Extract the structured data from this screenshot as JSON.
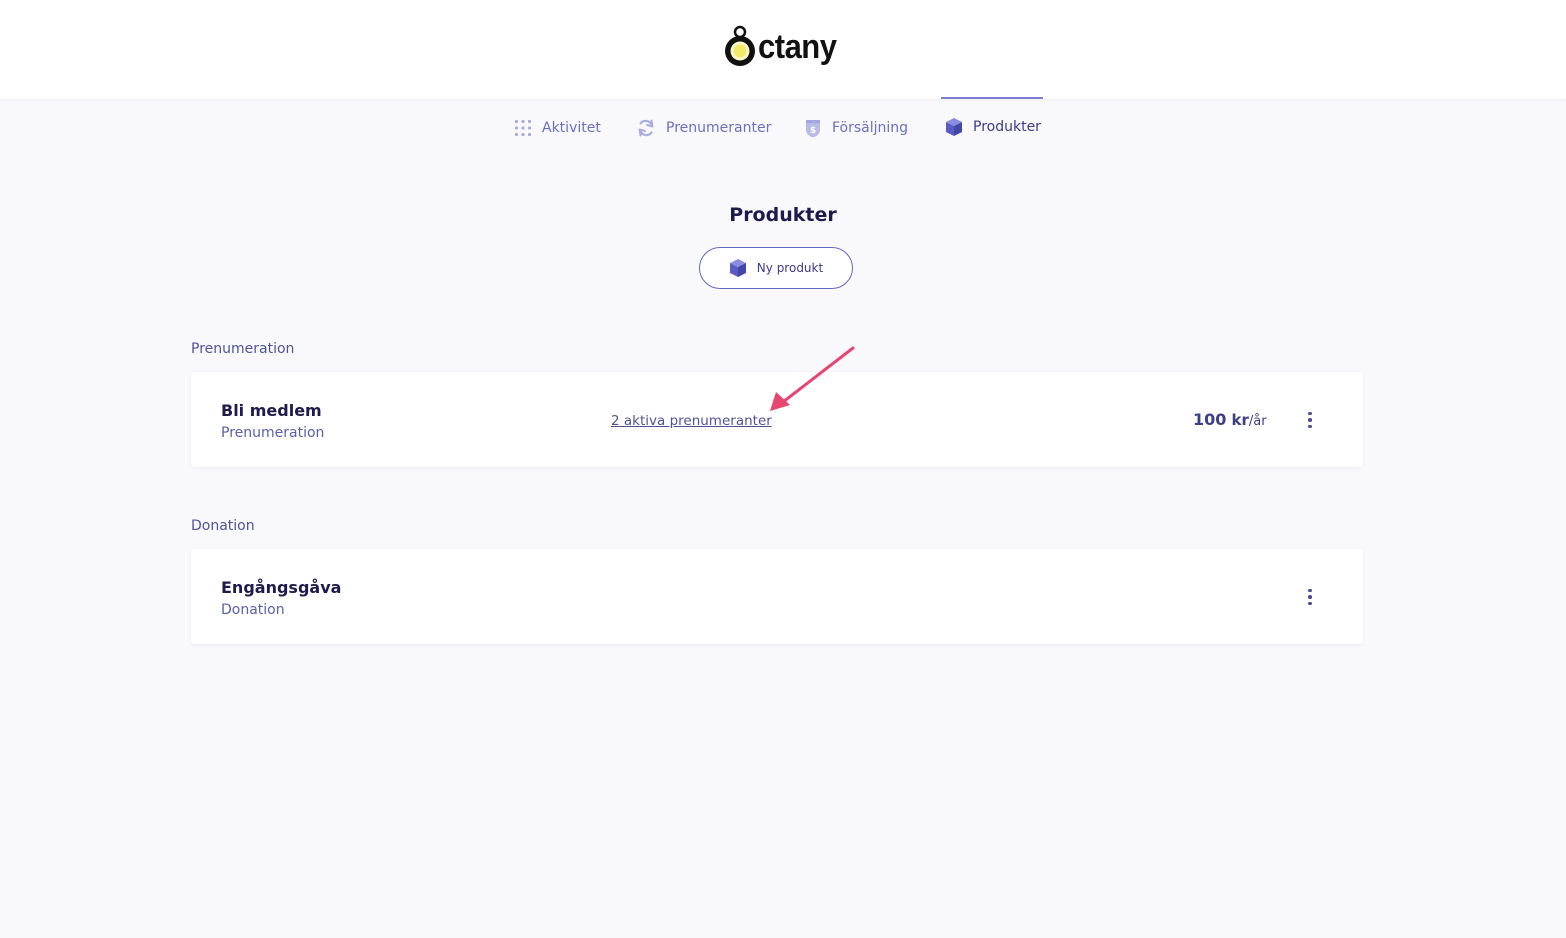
{
  "brand": {
    "name": "ctany"
  },
  "nav": {
    "items": [
      {
        "label": "Aktivitet",
        "icon": "grid-icon",
        "active": false
      },
      {
        "label": "Prenumeranter",
        "icon": "refresh-icon",
        "active": false
      },
      {
        "label": "Försäljning",
        "icon": "dollar-shield-icon",
        "active": false
      },
      {
        "label": "Produkter",
        "icon": "cube-icon",
        "active": true
      }
    ]
  },
  "page": {
    "title": "Produkter",
    "new_button": "Ny produkt"
  },
  "sections": [
    {
      "label": "Prenumeration",
      "products": [
        {
          "name": "Bli medlem",
          "type": "Prenumeration",
          "link": "2 aktiva prenumeranter",
          "price_amount": "100",
          "price_unit": "kr",
          "price_period": "/år"
        }
      ]
    },
    {
      "label": "Donation",
      "products": [
        {
          "name": "Engångsgåva",
          "type": "Donation"
        }
      ]
    }
  ],
  "colors": {
    "accent": "#6567c4",
    "annotation_arrow": "#e8456f",
    "background": "#f9f9fc"
  }
}
